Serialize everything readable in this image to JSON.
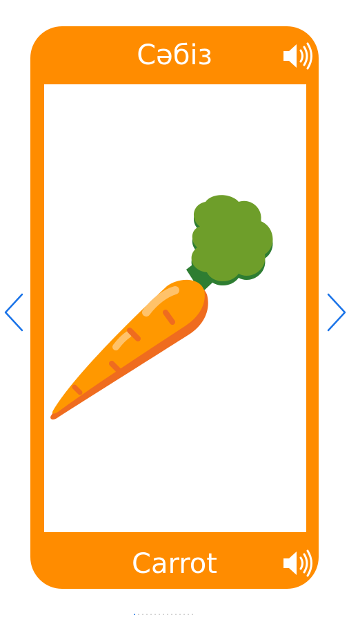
{
  "card": {
    "word_native": "Сәбіз",
    "word_english": "Carrot",
    "image_name": "carrot-illustration",
    "color": "#ff8c00"
  },
  "icons": {
    "audio_native": "speaker-icon",
    "audio_english": "speaker-icon",
    "prev": "chevron-left-icon",
    "next": "chevron-right-icon"
  },
  "pager": {
    "total": 15,
    "current": 1,
    "active_color": "#1a73e8"
  }
}
